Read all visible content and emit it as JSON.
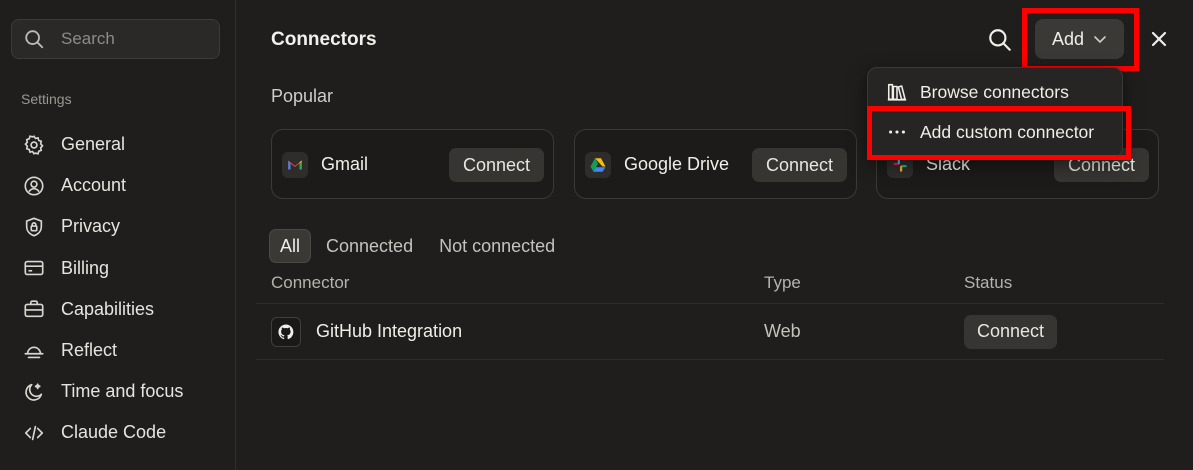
{
  "sidebar": {
    "search_placeholder": "Search",
    "settings_label": "Settings",
    "items": [
      {
        "label": "General",
        "icon": "gear-icon"
      },
      {
        "label": "Account",
        "icon": "user-circle-icon"
      },
      {
        "label": "Privacy",
        "icon": "shield-lock-icon"
      },
      {
        "label": "Billing",
        "icon": "credit-card-icon"
      },
      {
        "label": "Capabilities",
        "icon": "briefcase-icon"
      },
      {
        "label": "Reflect",
        "icon": "sunset-icon"
      },
      {
        "label": "Time and focus",
        "icon": "moon-star-icon"
      },
      {
        "label": "Claude Code",
        "icon": "code-icon"
      }
    ]
  },
  "header": {
    "title": "Connectors",
    "add_label": "Add",
    "close_icon": "close-icon",
    "search_icon": "search-icon"
  },
  "popular": {
    "title": "Popular",
    "cards": [
      {
        "name": "Gmail",
        "connect_label": "Connect",
        "icon": "gmail-icon"
      },
      {
        "name": "Google Drive",
        "connect_label": "Connect",
        "icon": "google-drive-icon"
      },
      {
        "name": "Slack",
        "connect_label": "Connect",
        "icon": "slack-icon"
      }
    ]
  },
  "filters": [
    "All",
    "Connected",
    "Not connected"
  ],
  "table": {
    "columns": [
      "Connector",
      "Type",
      "Status"
    ],
    "rows": [
      {
        "name": "GitHub Integration",
        "type": "Web",
        "status_label": "Connect",
        "icon": "github-icon"
      }
    ]
  },
  "dropdown": {
    "items": [
      {
        "label": "Browse connectors",
        "icon": "library-icon"
      },
      {
        "label": "Add custom connector",
        "icon": "more-dots-icon"
      }
    ]
  },
  "colors": {
    "highlight": "#ff0000",
    "background": "#1f1e1d"
  }
}
